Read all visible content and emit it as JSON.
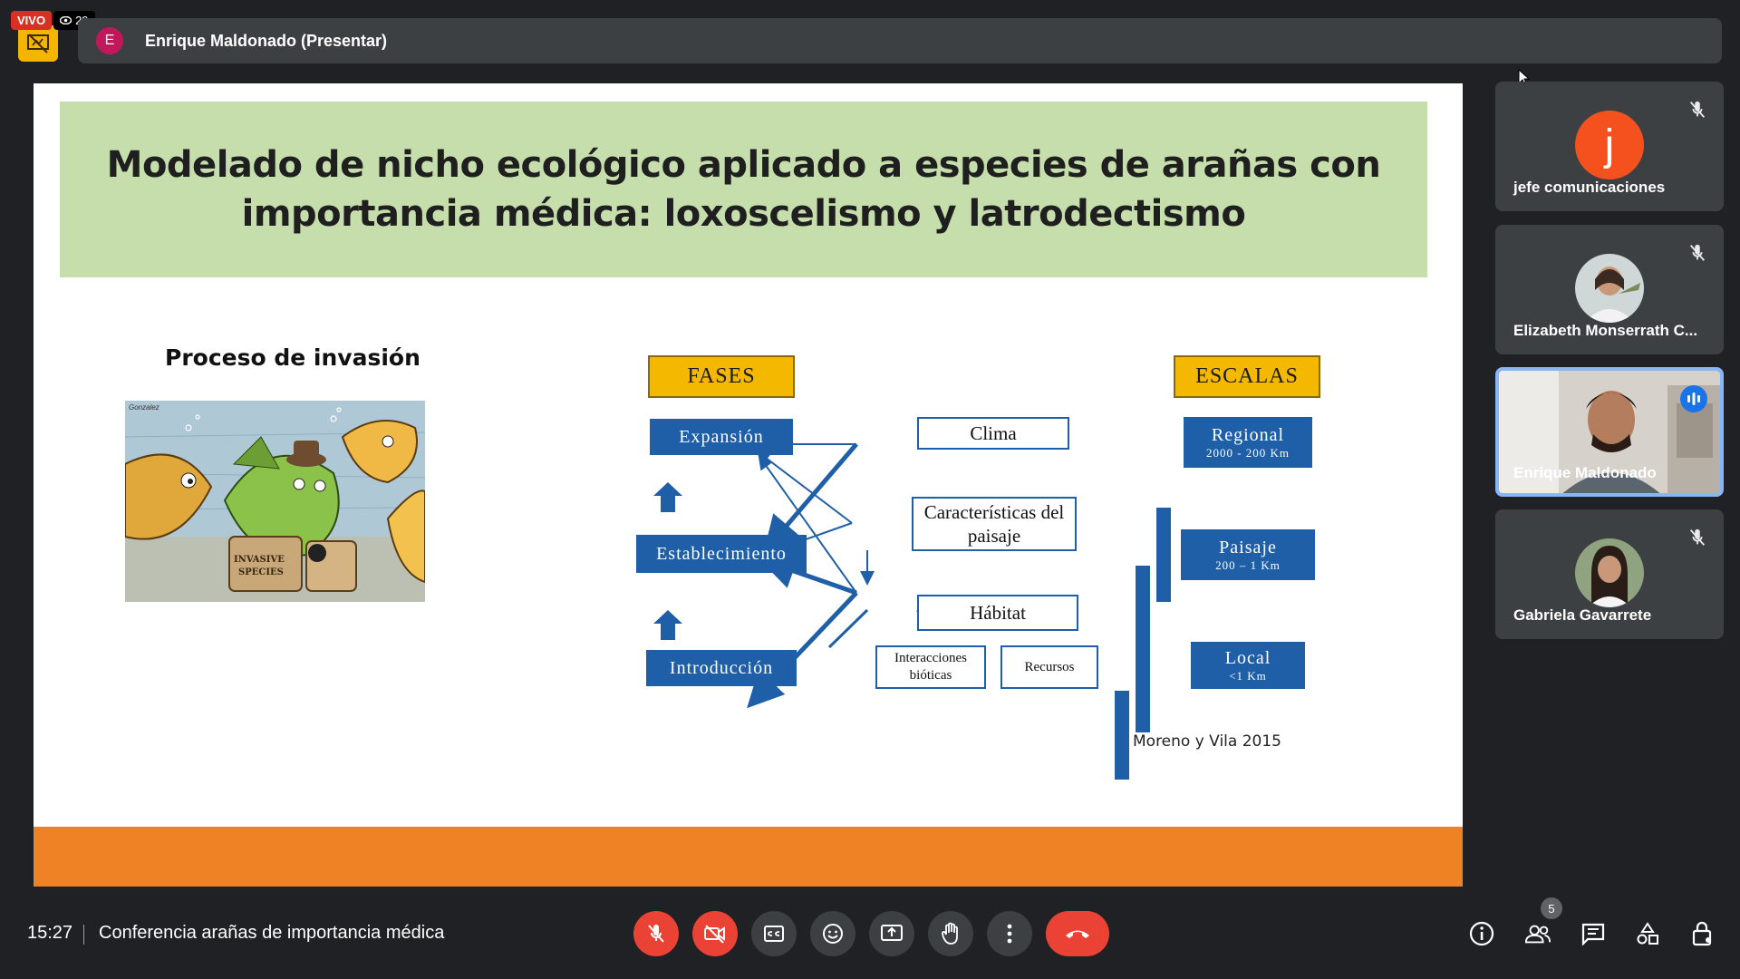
{
  "header": {
    "live_label": "VIVO",
    "viewer_count": "29",
    "presenter_initial": "E",
    "presenter_title": "Enrique Maldonado (Presentar)"
  },
  "slide": {
    "title": "Modelado de nicho ecológico aplicado a  especies de arañas con importancia médica: loxoscelismo y latrodectismo",
    "proceso_label": "Proceso de invasión",
    "cartoon": {
      "case_label": "INVASIVE SPECIES",
      "signature": "Gonzalez"
    },
    "diagram": {
      "fases_label": "FASES",
      "escalas_label": "ESCALAS",
      "expansion": "Expansión",
      "establecimiento": "Establecimiento",
      "introduccion": "Introducción",
      "clima": "Clima",
      "caracteristicas": "Características del paisaje",
      "habitat": "Hábitat",
      "interacciones": "Interacciones bióticas",
      "recursos": "Recursos",
      "regional": "Regional",
      "regional_range": "2000 - 200 Km",
      "paisaje": "Paisaje",
      "paisaje_range": "200 – 1 Km",
      "local": "Local",
      "local_range": "<1 Km"
    },
    "citation": "Moreno y Vila 2015"
  },
  "participants": [
    {
      "initial": "j",
      "name": "jefe comunicaciones",
      "muted": true
    },
    {
      "name": "Elizabeth Monserrath C...",
      "muted": true
    },
    {
      "name": "Enrique Maldonado",
      "speaking": true
    },
    {
      "name": "Gabriela Gavarrete",
      "muted": true
    }
  ],
  "footer": {
    "time": "15:27",
    "meeting_title": "Conferencia arañas de importancia médica",
    "people_count": "5"
  },
  "icons": {
    "mic": "mic-off-icon",
    "camera": "camera-off-icon",
    "captions": "captions-icon",
    "emoji": "emoji-icon",
    "present": "present-icon",
    "hand": "raise-hand-icon",
    "more": "more-options-icon",
    "end": "end-call-icon",
    "info": "info-icon",
    "people": "people-icon",
    "chat": "chat-icon",
    "activities": "activities-icon",
    "lock": "host-controls-icon"
  },
  "colors": {
    "background": "#202124",
    "tile": "#3c4043",
    "danger": "#ea4335",
    "title_box": "#c5deac",
    "orange_band": "#ee8225",
    "diagram_blue": "#1f5fa8",
    "diagram_gold": "#f5b800"
  }
}
